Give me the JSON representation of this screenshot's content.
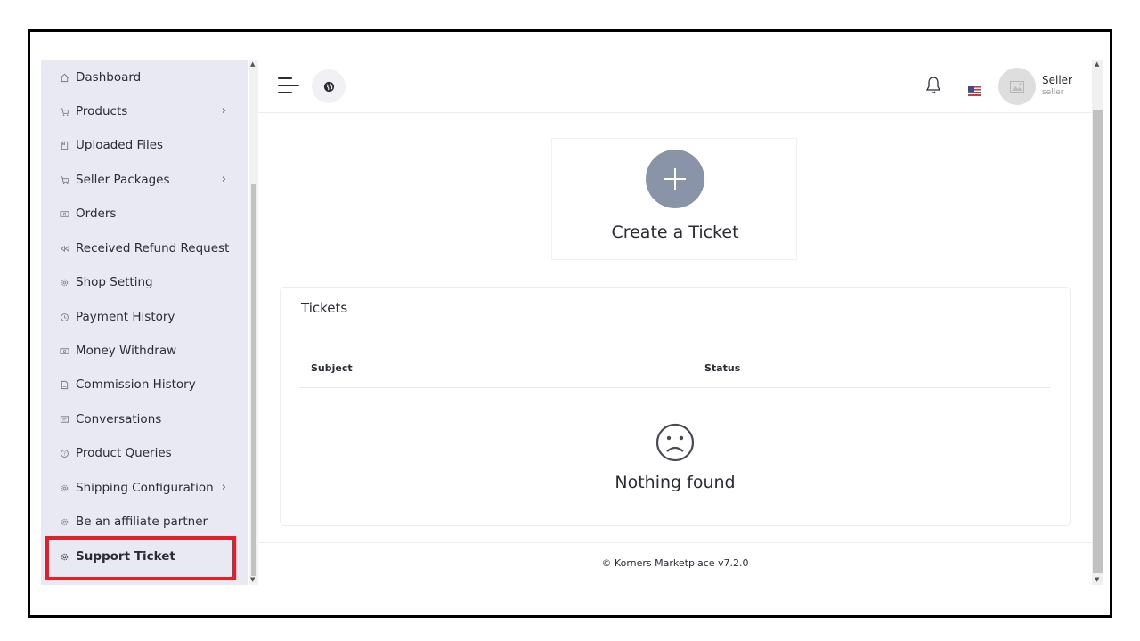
{
  "sidebar": {
    "items": [
      {
        "label": "Dashboard",
        "icon": "home-icon",
        "has_chevron": false
      },
      {
        "label": "Products",
        "icon": "cart-icon",
        "has_chevron": true
      },
      {
        "label": "Uploaded Files",
        "icon": "folder-icon",
        "has_chevron": false
      },
      {
        "label": "Seller Packages",
        "icon": "cart-icon",
        "has_chevron": true
      },
      {
        "label": "Orders",
        "icon": "money-icon",
        "has_chevron": false
      },
      {
        "label": "Received Refund Request",
        "icon": "backward-icon",
        "has_chevron": false
      },
      {
        "label": "Shop Setting",
        "icon": "gear-icon",
        "has_chevron": false
      },
      {
        "label": "Payment History",
        "icon": "history-icon",
        "has_chevron": false
      },
      {
        "label": "Money Withdraw",
        "icon": "money-icon",
        "has_chevron": false
      },
      {
        "label": "Commission History",
        "icon": "file-icon",
        "has_chevron": false
      },
      {
        "label": "Conversations",
        "icon": "chat-icon",
        "has_chevron": false
      },
      {
        "label": "Product Queries",
        "icon": "question-icon",
        "has_chevron": false
      },
      {
        "label": "Shipping Configuration",
        "icon": "gear-icon",
        "has_chevron": true
      },
      {
        "label": "Be an affiliate partner",
        "icon": "gear-icon",
        "has_chevron": false
      },
      {
        "label": "Support Ticket",
        "icon": "gear-icon",
        "has_chevron": false,
        "active": true
      }
    ],
    "chevron": "›"
  },
  "header": {
    "user_name": "Seller",
    "user_role": "seller"
  },
  "create_ticket": {
    "label": "Create a Ticket"
  },
  "tickets": {
    "title": "Tickets",
    "columns": [
      "Subject",
      "Status"
    ],
    "empty_text": "Nothing found"
  },
  "footer": {
    "text": "© Korners Marketplace v7.2.0"
  },
  "colors": {
    "sidebar_bg": "#e8e9f2",
    "highlight": "#e3202a",
    "plus_circle": "#8a94a9"
  }
}
